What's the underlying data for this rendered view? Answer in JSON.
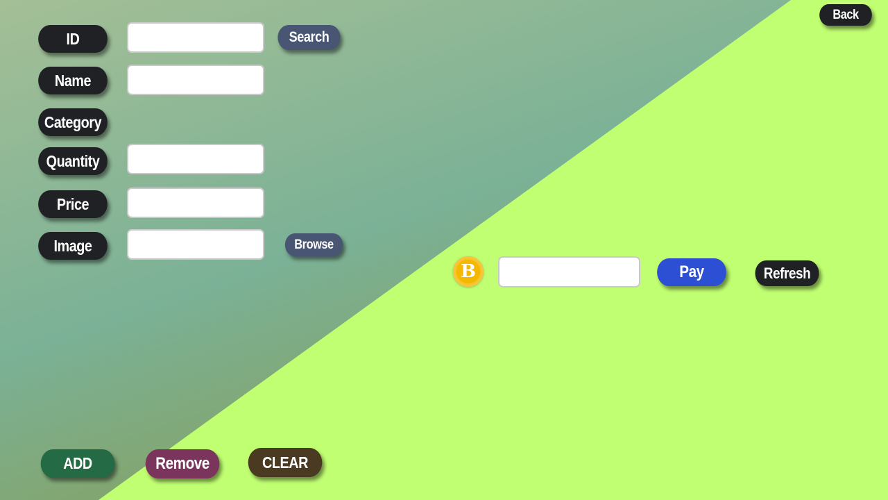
{
  "colors": {
    "background_right": "#c1ff72",
    "background_left_top": "#a4bf96",
    "background_left_mid": "#7bb196",
    "background_left_bottom": "#879e57",
    "label_bg": "#202124",
    "search_bg": "#485674",
    "browse_bg": "#485674",
    "pay_bg": "#2c4fd3",
    "add_bg": "#246a44",
    "remove_bg": "#7b355c",
    "clear_bg": "#4a3a21",
    "coin": "#f5b800"
  },
  "header": {
    "back_label": "Back"
  },
  "form": {
    "id_label": "ID",
    "id_value": "",
    "search_label": "Search",
    "name_label": "Name",
    "name_value": "",
    "category_label": "Category",
    "quantity_label": "Quantity",
    "quantity_value": "",
    "price_label": "Price",
    "price_value": "",
    "image_label": "Image",
    "image_value": "",
    "browse_label": "Browse"
  },
  "actions": {
    "add_label": "ADD",
    "remove_label": "Remove",
    "clear_label": "CLEAR"
  },
  "payment": {
    "coin_icon": "bitcoin-coin-icon",
    "coin_glyph": "B",
    "amount_value": "",
    "pay_label": "Pay",
    "refresh_label": "Refresh"
  }
}
